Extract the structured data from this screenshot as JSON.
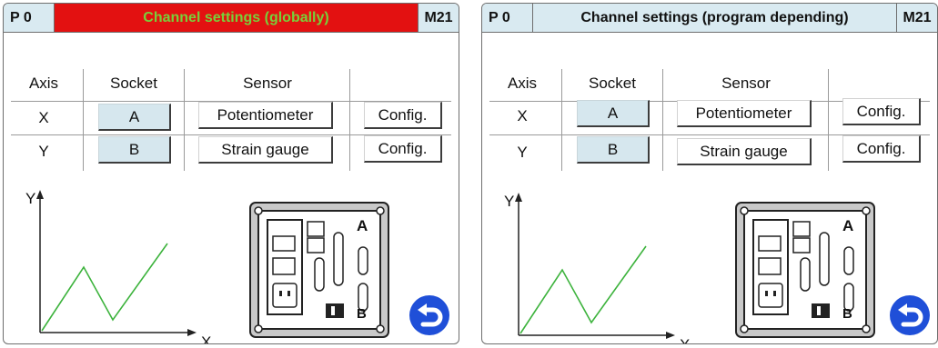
{
  "panels": [
    {
      "prog": "P 0",
      "title": "Channel settings (globally)",
      "code": "M21",
      "title_bg": "#e31111",
      "title_color": "#78d03a",
      "headers": {
        "axis": "Axis",
        "socket": "Socket",
        "sensor": "Sensor"
      },
      "rows": [
        {
          "axis": "X",
          "socket": "A",
          "sensor": "Potentiometer",
          "config": "Config."
        },
        {
          "axis": "Y",
          "socket": "B",
          "sensor": "Strain gauge",
          "config": "Config."
        }
      ],
      "graph": {
        "y_label": "Y",
        "x_label": "X",
        "line_color": "#3db33d"
      },
      "connector": {
        "label_a": "A",
        "label_b": "B"
      }
    },
    {
      "prog": "P 0",
      "title": "Channel settings (program depending)",
      "code": "M21",
      "title_bg": "#d9eaf1",
      "title_color": "#111111",
      "headers": {
        "axis": "Axis",
        "socket": "Socket",
        "sensor": "Sensor"
      },
      "rows": [
        {
          "axis": "X",
          "socket": "A",
          "sensor": "Potentiometer",
          "config": "Config."
        },
        {
          "axis": "Y",
          "socket": "B",
          "sensor": "Strain gauge",
          "config": "Config."
        }
      ],
      "graph": {
        "y_label": "Y",
        "x_label": "X",
        "line_color": "#3db33d"
      },
      "connector": {
        "label_a": "A",
        "label_b": "B"
      }
    }
  ],
  "icons": {
    "back": "return-arrow-icon"
  },
  "colors": {
    "back_button": "#1f4fd8",
    "button_bg": "#d6e7ee"
  }
}
